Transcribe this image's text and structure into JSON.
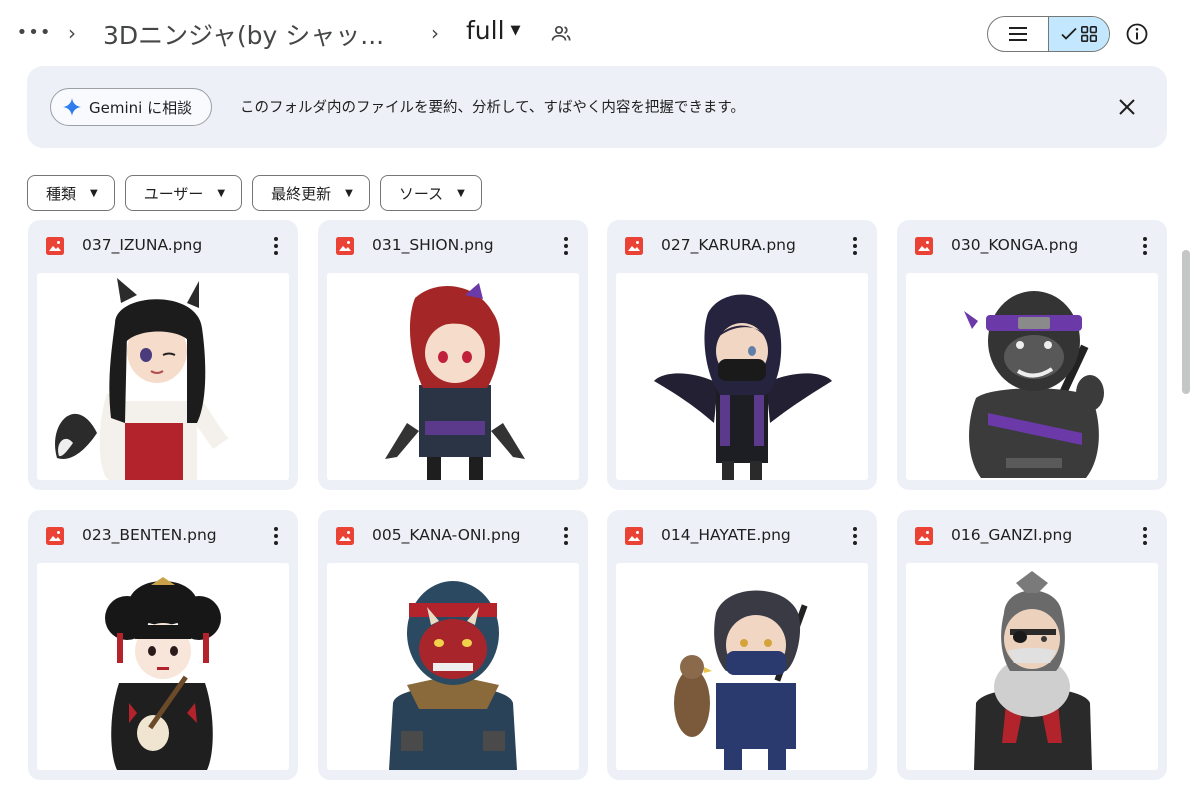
{
  "breadcrumb": {
    "more": "•••",
    "parent": "3Dニンジャ(by シャッ...",
    "current": "full",
    "separator": "›"
  },
  "icons": {
    "more": "more-horizontal-icon",
    "shared": "people-icon",
    "list_view": "list-view-icon",
    "grid_view": "grid-view-icon",
    "check": "check-icon",
    "info": "info-icon",
    "gemini": "gemini-sparkle-icon",
    "close": "close-icon",
    "image_file": "image-file-icon",
    "more_actions": "more-vert-icon"
  },
  "banner": {
    "button_label": "Gemini に相談",
    "text": "このフォルダ内のファイルを要約、分析して、すばやく内容を把握できます。"
  },
  "filters": [
    {
      "label": "種類"
    },
    {
      "label": "ユーザー"
    },
    {
      "label": "最終更新"
    },
    {
      "label": "ソース"
    }
  ],
  "files": [
    {
      "name": "037_IZUNA.png",
      "character": "fox-eared shrine maiden figure"
    },
    {
      "name": "031_SHION.png",
      "character": "red-haired kunoichi figure"
    },
    {
      "name": "027_KARURA.png",
      "character": "winged masked ninja figure"
    },
    {
      "name": "030_KONGA.png",
      "character": "gorilla ninja figure"
    },
    {
      "name": "023_BENTEN.png",
      "character": "geisha with shamisen figure"
    },
    {
      "name": "005_KANA-ONI.png",
      "character": "red oni mask ninja figure"
    },
    {
      "name": "014_HAYATE.png",
      "character": "ninja with hawk figure"
    },
    {
      "name": "016_GANZI.png",
      "character": "eyepatch elder ninja figure"
    }
  ],
  "colors": {
    "accent": "#c2e7ff",
    "card_bg": "#edf1f7",
    "file_icon": "#ea4335",
    "text": "#1f1f1f"
  }
}
